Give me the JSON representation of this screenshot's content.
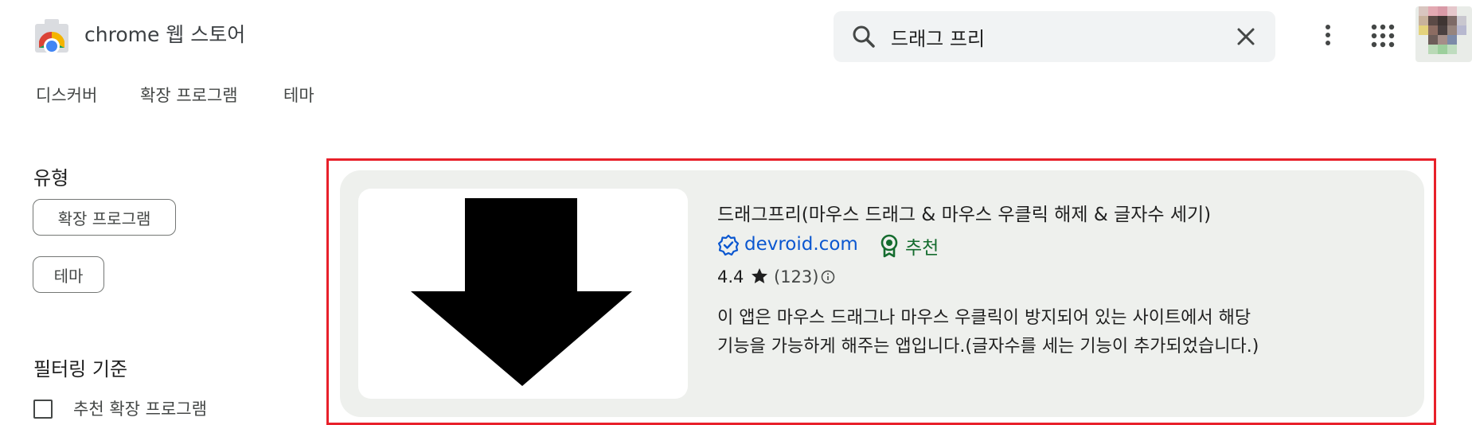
{
  "header": {
    "store_title": "chrome 웹 스토어",
    "search_value": "드래그 프리",
    "icons": [
      "chrome-logo",
      "search-icon",
      "close-icon",
      "more-vert-icon",
      "apps-grid-icon",
      "avatar"
    ]
  },
  "nav": {
    "items": [
      "디스커버",
      "확장 프로그램",
      "테마"
    ]
  },
  "sidebar": {
    "type_heading": "유형",
    "type_chips": [
      "확장 프로그램",
      "테마"
    ],
    "filter_heading": "필터링 기준",
    "filter_options": [
      {
        "label": "추천 확장 프로그램",
        "checked": false
      }
    ]
  },
  "result": {
    "title": "드래그프리(마우스 드래그 & 마우스 우클릭 해제 & 글자수 세기)",
    "publisher": "devroid.com",
    "publisher_verified": true,
    "badge": "추천",
    "rating": "4.4",
    "rating_count": "(123)",
    "description_lines": [
      "이 앱은 마우스 드래그나 마우스 우클릭이 방지되어 있는 사이트에서 해당",
      "기능을 가능하게 해주는 앱입니다.(글자수를 세는 기능이 추가되었습니다.)"
    ],
    "image_icon": "down-arrow-icon"
  },
  "colors": {
    "highlight_border": "#e8202a",
    "card_background": "#eef0ed",
    "link_blue": "#0b57d0",
    "featured_green": "#146c2e"
  }
}
